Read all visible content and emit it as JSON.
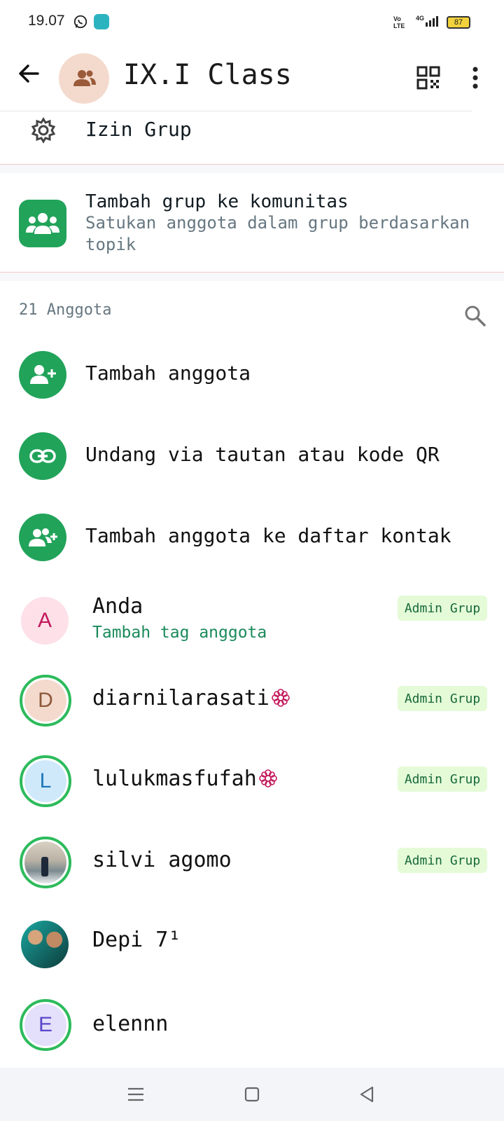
{
  "status": {
    "time": "19.07",
    "network": "Vo LTE",
    "signal": "4G",
    "battery": "87"
  },
  "header": {
    "title": "IX.I Class"
  },
  "settings": {
    "izin_label": "Izin Grup"
  },
  "community": {
    "title": "Tambah grup ke komunitas",
    "subtitle": "Satukan anggota dalam grup berdasarkan topik"
  },
  "members": {
    "count_label": "21 Anggota",
    "actions": [
      {
        "label": "Tambah anggota",
        "icon": "add-person-icon"
      },
      {
        "label": "Undang via tautan atau kode QR",
        "icon": "link-icon"
      },
      {
        "label": "Tambah anggota ke daftar kontak",
        "icon": "add-contacts-icon"
      }
    ],
    "list": [
      {
        "name": "Anda",
        "subtitle": "Tambah tag anggota",
        "initial": "A",
        "badge": "Admin Grup",
        "avatar_bg": "#fde0e8",
        "avatar_fg": "#c2185b"
      },
      {
        "name": "diarnilarasati",
        "initial": "D",
        "badge": "Admin Grup",
        "avatar_bg": "#f4dacd",
        "avatar_fg": "#8d5a3b"
      },
      {
        "name": "lulukmasfufah",
        "initial": "L",
        "badge": "Admin Grup",
        "avatar_bg": "#cfe9fb",
        "avatar_fg": "#1d77b8"
      },
      {
        "name": "silvi agomo",
        "badge": "Admin Grup"
      },
      {
        "name": "Depi 7¹"
      },
      {
        "name": "elennn",
        "initial": "E",
        "avatar_bg": "#e4e0fb",
        "avatar_fg": "#5a47c8"
      }
    ]
  },
  "colors": {
    "accent": "#21a35a",
    "ring": "#2dbb5c",
    "badge_bg": "#e5fbd8",
    "badge_fg": "#17693a"
  }
}
